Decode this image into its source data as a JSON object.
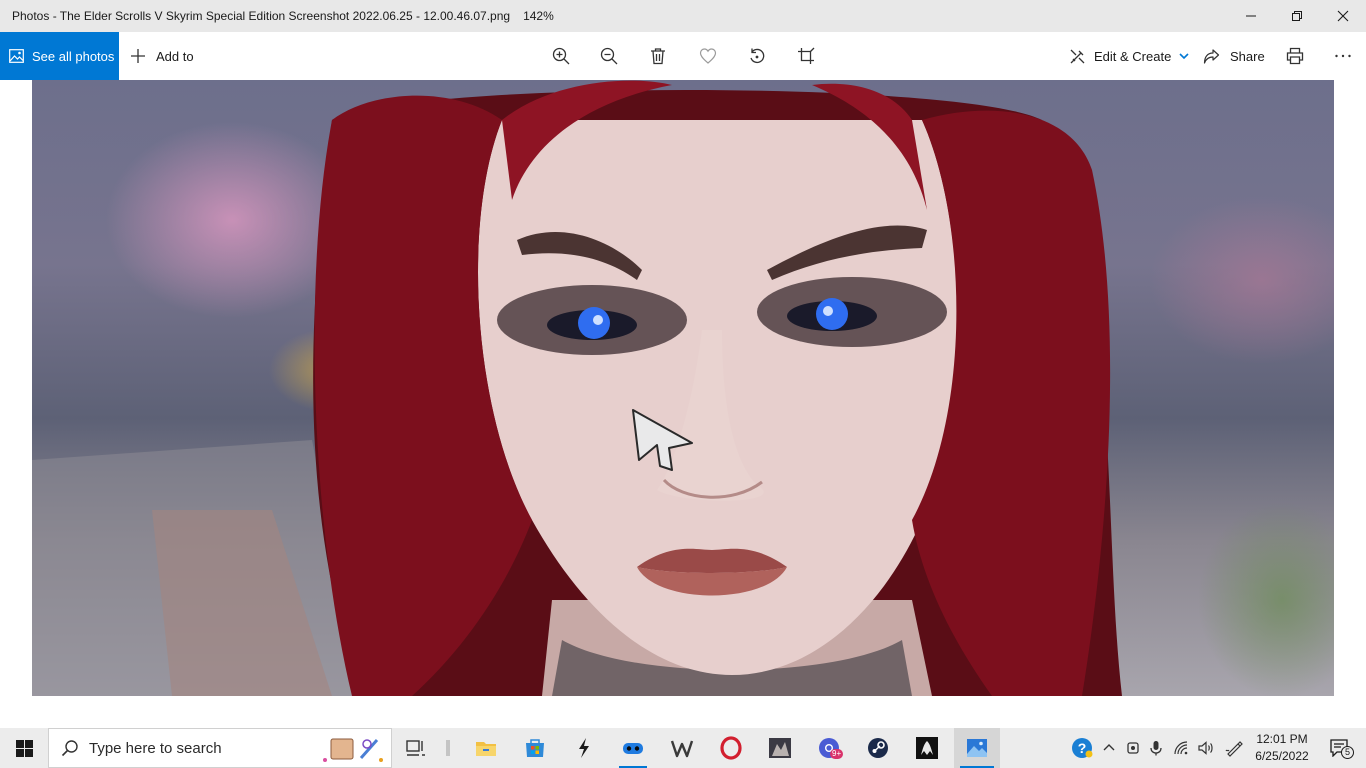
{
  "window": {
    "title": "Photos - The Elder Scrolls V  Skyrim Special Edition Screenshot 2022.06.25 - 12.00.46.07.png",
    "zoom_level": "142%",
    "minimize_icon": "minimize-icon",
    "restore_icon": "restore-icon",
    "close_icon": "close-icon"
  },
  "toolbar": {
    "see_all_label": "See all photos",
    "add_to_label": "Add to",
    "edit_create_label": "Edit & Create",
    "share_label": "Share",
    "icons": [
      "zoom-in-icon",
      "zoom-out-icon",
      "delete-icon",
      "favorite-icon",
      "rotate-icon",
      "crop-icon",
      "print-icon",
      "more-icon"
    ]
  },
  "taskbar": {
    "search_placeholder": "Type here to search",
    "time": "12:01 PM",
    "date": "6/25/2022",
    "notification_count": "5",
    "chrome_badge": "9+",
    "accent_color": "#0078d4"
  }
}
